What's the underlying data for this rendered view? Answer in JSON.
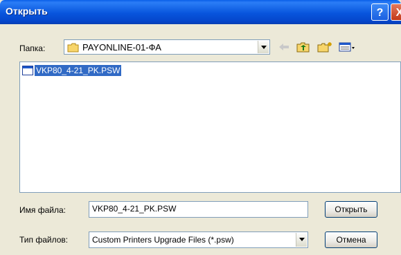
{
  "window": {
    "title": "Открыть",
    "help_label": "?",
    "close_label": "X"
  },
  "toolbar": {
    "folder_label": "Папка:",
    "folder_value": "PAYONLINE-01-ФА",
    "icons": [
      "back-arrow-icon",
      "up-folder-icon",
      "new-folder-icon",
      "view-menu-icon"
    ]
  },
  "files": [
    {
      "name": "VKP80_4-21_PK.PSW",
      "selected": true
    }
  ],
  "form": {
    "filename_label": "Имя файла:",
    "filename_value": "VKP80_4-21_PK.PSW",
    "filetype_label": "Тип файлов:",
    "filetype_value": "Custom Printers Upgrade Files (*.psw)"
  },
  "buttons": {
    "open": "Открыть",
    "cancel": "Отмена"
  },
  "colors": {
    "titlebar": "#0855dd",
    "selection": "#316ac5",
    "dialog_bg": "#ece9d8"
  }
}
